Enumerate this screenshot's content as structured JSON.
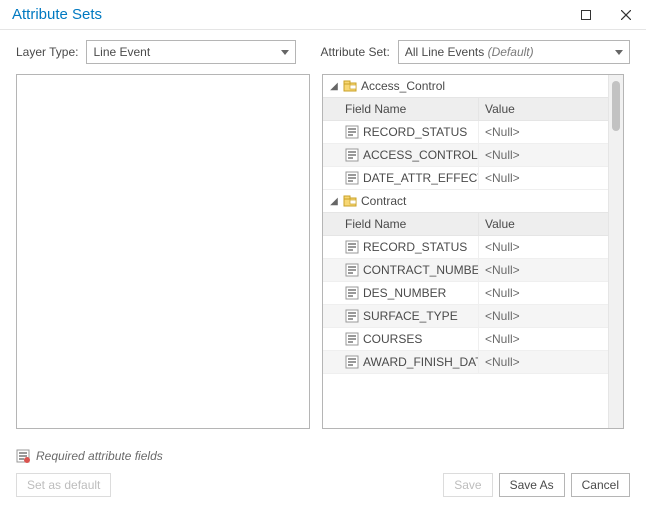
{
  "title": "Attribute Sets",
  "layer_type_label": "Layer Type:",
  "layer_type_value": "Line Event",
  "attribute_set_label": "Attribute Set:",
  "attribute_set_value": "All Line Events",
  "attribute_set_default_tag": "(Default)",
  "footer_note": "Required attribute fields",
  "buttons": {
    "set_default": "Set as default",
    "save": "Save",
    "save_as": "Save As",
    "cancel": "Cancel"
  },
  "groups": [
    {
      "name": "Access_Control",
      "header_field": "Field Name",
      "header_value": "Value",
      "rows": [
        {
          "field": "RECORD_STATUS",
          "value": "<Null>"
        },
        {
          "field": "ACCESS_CONTROL",
          "value": "<Null>"
        },
        {
          "field": "DATE_ATTR_EFFECTIVE",
          "value": "<Null>"
        }
      ]
    },
    {
      "name": "Contract",
      "header_field": "Field Name",
      "header_value": "Value",
      "rows": [
        {
          "field": "RECORD_STATUS",
          "value": "<Null>"
        },
        {
          "field": "CONTRACT_NUMBER",
          "value": "<Null>"
        },
        {
          "field": "DES_NUMBER",
          "value": "<Null>"
        },
        {
          "field": "SURFACE_TYPE",
          "value": "<Null>"
        },
        {
          "field": "COURSES",
          "value": "<Null>"
        },
        {
          "field": "AWARD_FINISH_DATE",
          "value": "<Null>"
        }
      ]
    }
  ]
}
